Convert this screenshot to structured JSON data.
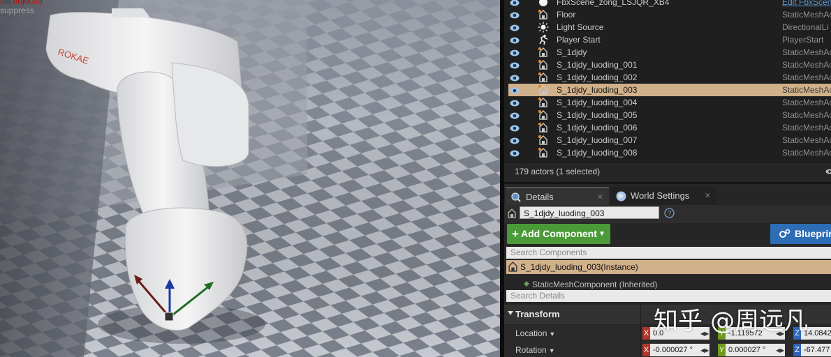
{
  "viewport": {
    "warning_text": "uilt objects)",
    "suppress_text": "suppress",
    "robot_brand": "ROKAE"
  },
  "outliner": {
    "rows": [
      {
        "name": "FbxScene_zong_LSJQR_XB4",
        "type": "Edit FbxScen",
        "icon": "sphere-icon",
        "selected": false
      },
      {
        "name": "Floor",
        "type": "StaticMeshAc",
        "icon": "static-mesh-icon",
        "selected": false
      },
      {
        "name": "Light Source",
        "type": "DirectionalLi",
        "icon": "light-source-icon",
        "selected": false
      },
      {
        "name": "Player Start",
        "type": "PlayerStart",
        "icon": "player-start-icon",
        "selected": false
      },
      {
        "name": "S_1djdy",
        "type": "StaticMeshAc",
        "icon": "static-mesh-icon",
        "selected": false
      },
      {
        "name": "S_1djdy_luoding_001",
        "type": "StaticMeshAc",
        "icon": "static-mesh-icon",
        "selected": false
      },
      {
        "name": "S_1djdy_luoding_002",
        "type": "StaticMeshAc",
        "icon": "static-mesh-icon",
        "selected": false
      },
      {
        "name": "S_1djdy_luoding_003",
        "type": "StaticMeshAc",
        "icon": "static-mesh-icon",
        "selected": true
      },
      {
        "name": "S_1djdy_luoding_004",
        "type": "StaticMeshAc",
        "icon": "static-mesh-icon",
        "selected": false
      },
      {
        "name": "S_1djdy_luoding_005",
        "type": "StaticMeshAc",
        "icon": "static-mesh-icon",
        "selected": false
      },
      {
        "name": "S_1djdy_luoding_006",
        "type": "StaticMeshAc",
        "icon": "static-mesh-icon",
        "selected": false
      },
      {
        "name": "S_1djdy_luoding_007",
        "type": "StaticMeshAc",
        "icon": "static-mesh-icon",
        "selected": false
      },
      {
        "name": "S_1djdy_luoding_008",
        "type": "StaticMeshAc",
        "icon": "static-mesh-icon",
        "selected": false
      }
    ],
    "actor_count": "179 actors (1 selected)"
  },
  "details": {
    "tabs": [
      {
        "label": "Details",
        "icon": "magnifier-icon"
      },
      {
        "label": "World Settings",
        "icon": "globe-icon"
      }
    ],
    "actor_name": "S_1djdy_luoding_003",
    "add_component_label": "Add Component",
    "blueprint_label": "Blueprint",
    "search_components_placeholder": "Search Components",
    "instance_label": "S_1djdy_luoding_003(Instance)",
    "component_label": "StaticMeshComponent (Inherited)",
    "search_details_placeholder": "Search Details",
    "transform_label": "Transform",
    "location": {
      "label": "Location",
      "x": "0.0",
      "y": "-1.119572",
      "z": "14.0842"
    },
    "rotation": {
      "label": "Rotation",
      "x": "-0.000027 °",
      "y": "0.000027 °",
      "z": "-67.477"
    },
    "axis_labels": {
      "x": "X",
      "y": "Y",
      "z": "Z"
    }
  },
  "watermark": "知乎 @周远凡",
  "colors": {
    "selection": "#d1b18a",
    "add_component": "#4b9a38",
    "blueprint": "#2c6db5",
    "axis_x": "#b3342a",
    "axis_y": "#6e9a1c",
    "axis_z": "#2f65b8"
  }
}
